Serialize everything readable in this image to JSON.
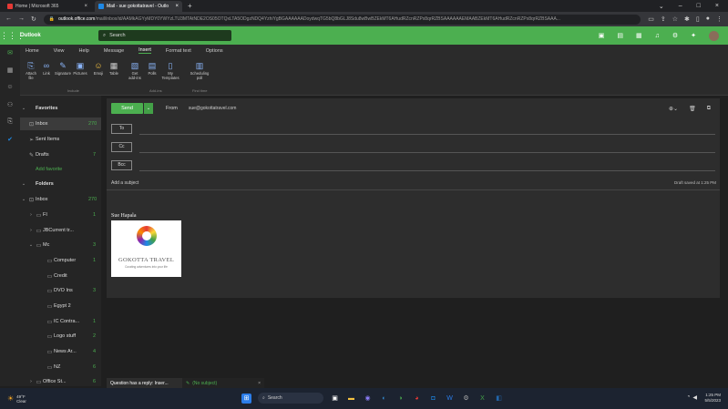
{
  "browser": {
    "tabs": [
      {
        "label": "Home | Microsoft 365",
        "color": "#e53935"
      },
      {
        "label": "Mail - sue gokottatravel - Outlo",
        "color": "#1e88e5"
      }
    ],
    "url_host": "outlook.office.com",
    "url_path": "/mail/inbox/id/AAMkAGYyMDY0YWYzLTU3MTAtNDE2OS05OTQxLTA5ODgzNDQ4YzhiYgBGAAAAAADoydwqTG5bQ8bGLJ8Sdu8wBwBZEkMT6AHudRZcnRZPx8qrRZBSAAAAAAEMAABZEkMT6AHudRZcnRZPx8qrRZBSAAA..."
  },
  "outlook": {
    "app_name": "Outlook",
    "search_placeholder": "Search"
  },
  "ribbon": {
    "tabs": [
      "Home",
      "View",
      "Help",
      "Message",
      "Insert",
      "Format text",
      "Options"
    ],
    "active_tab": "Insert",
    "buttons": [
      "Attach file",
      "Link",
      "Signature",
      "Pictures",
      "Emoji",
      "Table",
      "Get add-ins",
      "Polls",
      "My Templates",
      "Scheduling poll"
    ],
    "groups": [
      "Include",
      "Add-ins",
      "Find time"
    ]
  },
  "folders": {
    "favorites_header": "Favorites",
    "folders_header": "Folders",
    "favorites": [
      {
        "label": "Inbox",
        "count": "270"
      },
      {
        "label": "Sent Items",
        "count": ""
      },
      {
        "label": "Drafts",
        "count": "7"
      }
    ],
    "add_favorite": "Add favorite",
    "tree": [
      {
        "label": "Inbox",
        "count": "270"
      },
      {
        "label": "FI",
        "count": "1"
      },
      {
        "label": "JBCurrent tr...",
        "count": ""
      },
      {
        "label": "Mc",
        "count": "3"
      },
      {
        "label": "Computer",
        "count": "1"
      },
      {
        "label": "Credit",
        "count": ""
      },
      {
        "label": "DVO Ins",
        "count": "3"
      },
      {
        "label": "Egypt 2",
        "count": ""
      },
      {
        "label": "IC Contra...",
        "count": "1"
      },
      {
        "label": "Logo stuff",
        "count": "2"
      },
      {
        "label": "News Ar...",
        "count": "4"
      },
      {
        "label": "NZ",
        "count": "6"
      },
      {
        "label": "Office St...",
        "count": "6"
      }
    ]
  },
  "compose": {
    "send_label": "Send",
    "from_label": "From",
    "from_value": "sue@gokottatravel.com",
    "to_label": "To",
    "cc_label": "Cc",
    "bcc_label": "Bcc",
    "subject_placeholder": "Add a subject",
    "draft_saved": "Draft saved at 1:25 PM",
    "signature_name": "Sue Hapala",
    "logo_brand": "GOKOTTA TRAVEL",
    "logo_tagline": "Curating adventures into your life"
  },
  "drafts_bar": {
    "tab_a": "Question has a reply: Inser...",
    "tab_b": "(No subject)"
  },
  "taskbar": {
    "temp": "49°F",
    "weather": "Clear",
    "search": "Search",
    "time": "1:25 PM",
    "date": "5/5/2023"
  }
}
